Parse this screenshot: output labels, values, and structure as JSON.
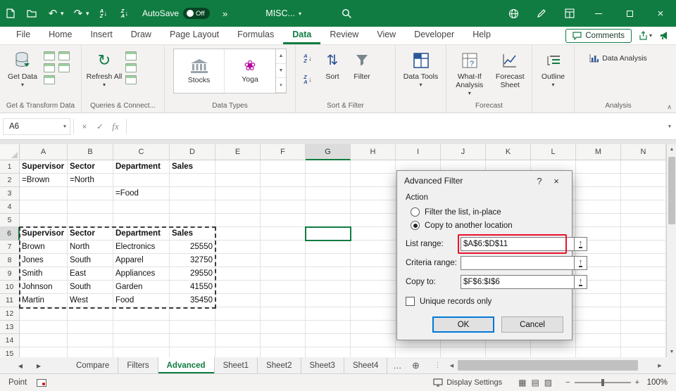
{
  "colors": {
    "brand": "#107C41",
    "annotation_red": "#E8112D",
    "ok_blue": "#0078D7"
  },
  "glyphs": {
    "undo": "↶",
    "redo": "↷",
    "more": "»",
    "dropdown": "▾",
    "close": "×",
    "cancel": "×",
    "enter": "✓",
    "fx": "fx",
    "help": "?",
    "picker": "↑",
    "refresh": "↻",
    "sort_pair": "⇅",
    "nav_left": "◀",
    "nav_right": "▶",
    "scroll_up": "▲",
    "scroll_down": "▼",
    "add_sheet": "⊕",
    "grip": "⋮",
    "zoom_out": "−",
    "zoom_in": "+",
    "view_normal": "▦",
    "view_layout": "▤",
    "view_break": "▨",
    "collapse": "∧",
    "flower": "❀",
    "letter_a": "A",
    "letter_z": "Z",
    "arrow_down": "↓"
  },
  "titlebar": {
    "autosave_label": "AutoSave",
    "autosave_state": "Off",
    "doc_name": "MISC..."
  },
  "ribbon": {
    "tabs": [
      "File",
      "Home",
      "Insert",
      "Draw",
      "Page Layout",
      "Formulas",
      "Data",
      "Review",
      "View",
      "Developer",
      "Help"
    ],
    "active_tab": "Data",
    "comments_label": "Comments",
    "groups": {
      "get_transform": {
        "label": "Get & Transform Data",
        "get_data": "Get Data"
      },
      "queries": {
        "label": "Queries & Connect...",
        "refresh_all": "Refresh All"
      },
      "data_types": {
        "label": "Data Types",
        "cards": [
          "Stocks",
          "Yoga"
        ]
      },
      "sort_filter": {
        "label": "Sort & Filter",
        "sort": "Sort",
        "filter": "Filter"
      },
      "data_tools": {
        "label": "Data Tools"
      },
      "forecast": {
        "label": "Forecast",
        "what_if": "What-If Analysis",
        "forecast_sheet": "Forecast Sheet"
      },
      "outline": {
        "label": "Outline"
      },
      "analysis": {
        "label": "Analysis",
        "data_analysis": "Data Analysis"
      }
    }
  },
  "formula_bar": {
    "name_box": "A6",
    "formula": ""
  },
  "grid": {
    "columns": [
      "A",
      "B",
      "C",
      "D",
      "E",
      "F",
      "G",
      "H",
      "I",
      "J",
      "K",
      "L",
      "M",
      "N"
    ],
    "rows": [
      "1",
      "2",
      "3",
      "4",
      "5",
      "6",
      "7",
      "8",
      "9",
      "10",
      "11",
      "12",
      "13",
      "14",
      "15"
    ],
    "active_cell": "G6",
    "active_column": "G",
    "active_row": "6",
    "marquee_range": "A6:D11",
    "cells": {
      "A1": {
        "text": "Supervisor",
        "bold": true
      },
      "B1": {
        "text": "Sector",
        "bold": true
      },
      "C1": {
        "text": "Department",
        "bold": true
      },
      "D1": {
        "text": "Sales",
        "bold": true
      },
      "A2": {
        "text": "=Brown"
      },
      "B2": {
        "text": "=North"
      },
      "C3": {
        "text": "=Food"
      },
      "A6": {
        "text": "Supervisor",
        "bold": true
      },
      "B6": {
        "text": "Sector",
        "bold": true
      },
      "C6": {
        "text": "Department",
        "bold": true
      },
      "D6": {
        "text": "Sales",
        "bold": true
      },
      "A7": {
        "text": "Brown"
      },
      "B7": {
        "text": "North"
      },
      "C7": {
        "text": "Electronics"
      },
      "D7": {
        "text": "25550",
        "align": "right"
      },
      "A8": {
        "text": "Jones"
      },
      "B8": {
        "text": "South"
      },
      "C8": {
        "text": "Apparel"
      },
      "D8": {
        "text": "32750",
        "align": "right"
      },
      "A9": {
        "text": "Smith"
      },
      "B9": {
        "text": "East"
      },
      "C9": {
        "text": "Appliances"
      },
      "D9": {
        "text": "29550",
        "align": "right"
      },
      "A10": {
        "text": "Johnson"
      },
      "B10": {
        "text": "South"
      },
      "C10": {
        "text": "Garden"
      },
      "D10": {
        "text": "41550",
        "align": "right"
      },
      "A11": {
        "text": "Martin"
      },
      "B11": {
        "text": "West"
      },
      "C11": {
        "text": "Food"
      },
      "D11": {
        "text": "35450",
        "align": "right"
      }
    }
  },
  "dialog": {
    "title": "Advanced Filter",
    "action_label": "Action",
    "radios": [
      {
        "label": "Filter the list, in-place",
        "selected": false
      },
      {
        "label": "Copy to another location",
        "selected": true
      }
    ],
    "fields": [
      {
        "label": "List range:",
        "value": "$A$6:$D$11",
        "highlighted": true
      },
      {
        "label": "Criteria range:",
        "value": ""
      },
      {
        "label": "Copy to:",
        "value": "$F$6:$I$6"
      }
    ],
    "unique_label": "Unique records only",
    "unique_checked": false,
    "ok_label": "OK",
    "cancel_label": "Cancel"
  },
  "sheet_bar": {
    "tabs": [
      "Compare",
      "Filters",
      "Advanced",
      "Sheet1",
      "Sheet2",
      "Sheet3",
      "Sheet4"
    ],
    "active_tab": "Advanced",
    "overflow_label": "…"
  },
  "status_bar": {
    "mode": "Point",
    "display_settings": "Display Settings",
    "zoom_level": "100%"
  }
}
